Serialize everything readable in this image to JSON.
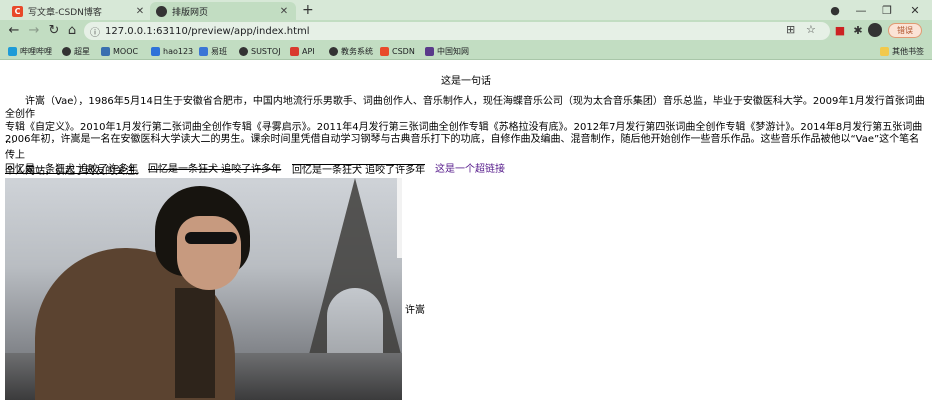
{
  "browser": {
    "tabs": [
      {
        "title": "写文章-CSDN博客",
        "icon": "csdn-icon",
        "active": false
      },
      {
        "title": "排版网页",
        "icon": "globe-icon",
        "active": true
      }
    ],
    "new_tab_label": "+",
    "address": {
      "info_icon": "info-icon",
      "url": "127.0.0.1:63110/preview/app/index.html"
    },
    "update_button_label": "错误",
    "bookmarks": [
      {
        "label": "哔哩哔哩",
        "color": "#1e9bd7"
      },
      {
        "label": "超星",
        "color": "#333333"
      },
      {
        "label": "MOOC",
        "color": "#3a6fb0"
      },
      {
        "label": "hao123",
        "color": "#2f72d9"
      },
      {
        "label": "易班",
        "color": "#3a75d6"
      },
      {
        "label": "SUSTOJ",
        "color": "#333333"
      },
      {
        "label": "API",
        "color": "#d93a2e"
      },
      {
        "label": "教务系统",
        "color": "#333333"
      },
      {
        "label": "CSDN",
        "color": "#e8492a"
      },
      {
        "label": "中国知网",
        "color": "#5a3a8a"
      }
    ],
    "other_bookmarks": "其他书签",
    "accent": "#c2ddc2"
  },
  "page": {
    "heading": "这是一句话",
    "para1": "许嵩（Vae），1986年5月14日生于安徽省合肥市，中国内地流行乐男歌手、词曲创作人、音乐制作人，现任海蝶音乐公司（现为太合音乐集团）音乐总监，毕业于安徽医科大学。2009年1月发行首张词曲全创作\n专辑《自定义》。2010年1月发行第二张词曲全创作专辑《寻雾启示》。2011年4月发行第三张词曲全创作专辑《苏格拉没有底》。2012年7月发行第四张词曲全创作专辑《梦游计》。2014年8月发行第五张词曲 ...",
    "para2": "2006年初，许嵩是一名在安徽医科大学读大二的男生。课余时间里凭借自动学习钢琴与古典音乐打下的功底，自修作曲及编曲、混音制作，随后他开始创作一些音乐作品。这些音乐作品被他以“Vae”这个笔名传上\n个人网站，引起了网友的关注。",
    "line_under": "回忆是一条狂犬 追咬了许多年",
    "line_strike": "回忆是一条狂犬 追咬了许多年",
    "line_over": "回忆是一条狂犬 追咬了许多年",
    "link_text": "这是一个超链接",
    "image_caption": "许嵩"
  }
}
